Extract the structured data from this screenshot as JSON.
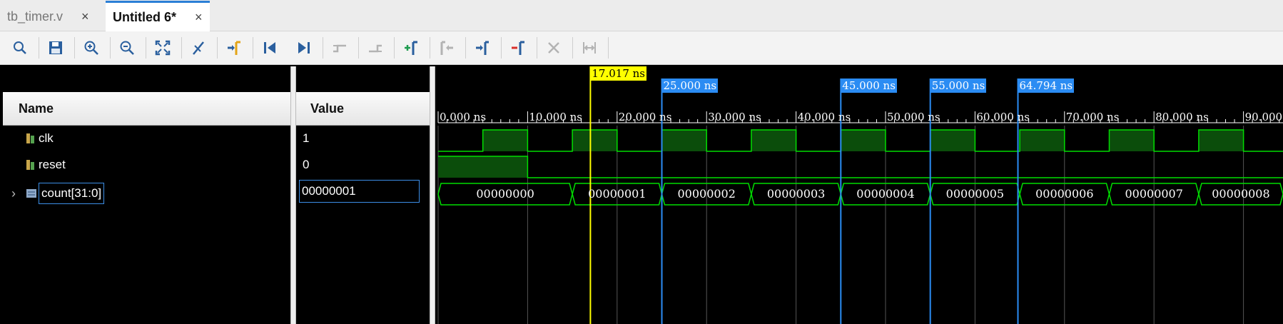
{
  "tabs": [
    {
      "label": "tb_timer.v",
      "close": "×"
    },
    {
      "label": "Untitled 6*",
      "close": "×"
    }
  ],
  "toolbar": {
    "icons": [
      "search-icon",
      "save-icon",
      "zoom-in-icon",
      "zoom-out-icon",
      "zoom-fit-icon",
      "cursor-snap-icon",
      "go-to-cursor-icon",
      "go-to-start-icon",
      "go-to-end-icon",
      "previous-transition-icon",
      "next-transition-icon",
      "add-marker-icon",
      "previous-marker-icon",
      "next-marker-icon",
      "delete-marker-icon",
      "swap-cursors-icon",
      "fit-markers-icon"
    ]
  },
  "headers": {
    "name": "Name",
    "value": "Value"
  },
  "signals": [
    {
      "name": "clk",
      "value": "1",
      "icon": "signal-icon"
    },
    {
      "name": "reset",
      "value": "0",
      "icon": "signal-icon"
    },
    {
      "name": "count[31:0]",
      "value": "00000001",
      "icon": "bus-icon",
      "expand": "›"
    }
  ],
  "cursor": {
    "label": "17.017 ns",
    "time_ns": 17.017,
    "color": "#ffff00"
  },
  "markers": [
    {
      "label": "25.000 ns",
      "time_ns": 25.0
    },
    {
      "label": "45.000 ns",
      "time_ns": 45.0
    },
    {
      "label": "55.000 ns",
      "time_ns": 55.0
    },
    {
      "label": "64.794 ns",
      "time_ns": 64.794
    }
  ],
  "ticks": [
    {
      "label": "0.000 ns",
      "time_ns": 0
    },
    {
      "label": "10.000 ns",
      "time_ns": 10
    },
    {
      "label": "20.000 ns",
      "time_ns": 20
    },
    {
      "label": "30.000 ns",
      "time_ns": 30
    },
    {
      "label": "40.000 ns",
      "time_ns": 40
    },
    {
      "label": "50.000 ns",
      "time_ns": 50
    },
    {
      "label": "60.000 ns",
      "time_ns": 60
    },
    {
      "label": "70.000 ns",
      "time_ns": 70
    },
    {
      "label": "80.000 ns",
      "time_ns": 80
    },
    {
      "label": "90.000",
      "time_ns": 90
    }
  ],
  "waves": {
    "clk_period_ns": 10,
    "clk_high_first_ns": 5,
    "reset_high_until_ns": 10,
    "bus_values": [
      "00000000",
      "00000001",
      "00000002",
      "00000003",
      "00000004",
      "00000005",
      "00000006",
      "00000007",
      "00000008"
    ],
    "bus_change_times_ns": [
      0,
      15,
      25,
      35,
      45,
      55,
      65,
      75,
      85
    ],
    "wave_color": "#00dd00",
    "fill_color": "#0b4d0b",
    "marker_color": "#2b8cf3"
  }
}
